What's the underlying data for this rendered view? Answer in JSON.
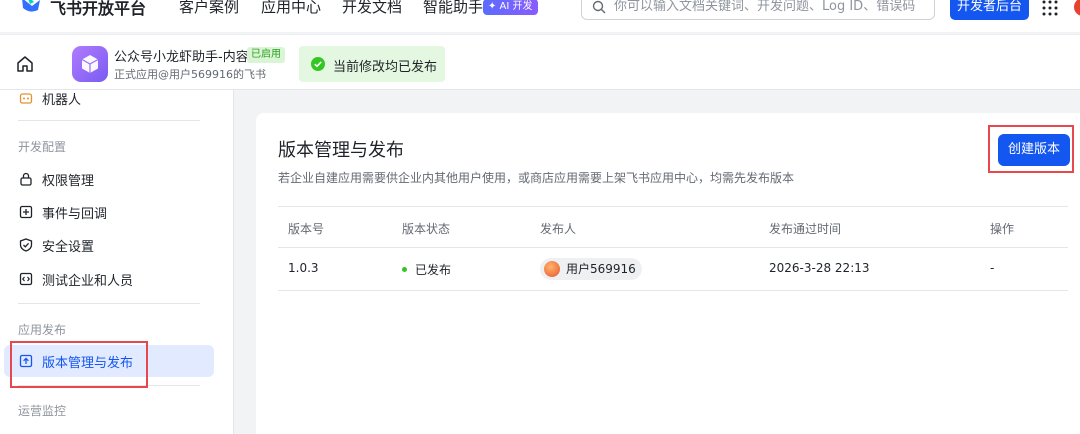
{
  "topbar": {
    "brand": "飞书开放平台",
    "nav": [
      "客户案例",
      "应用中心",
      "开发文档",
      "智能助手"
    ],
    "ai_badge": "✦ AI 开发",
    "search_placeholder": "你可以输入文档关键词、开发问题、Log ID、错误码",
    "dev_console_label": "开发者后台"
  },
  "appbar": {
    "app_name": "公众号小龙虾助手-内容",
    "enabled_badge": "已启用",
    "app_subtitle": "正式应用@用户569916的飞书",
    "publish_status": "当前修改均已发布"
  },
  "sidebar": {
    "top_item": "机器人",
    "groups": [
      {
        "title": "开发配置",
        "items": [
          "权限管理",
          "事件与回调",
          "安全设置",
          "测试企业和人员"
        ]
      },
      {
        "title": "应用发布",
        "items": [
          "版本管理与发布"
        ]
      },
      {
        "title": "运营监控",
        "items": []
      }
    ],
    "active_item": "版本管理与发布"
  },
  "main": {
    "title": "版本管理与发布",
    "description": "若企业自建应用需要供企业内其他用户使用，或商店应用需要上架飞书应用中心，均需先发布版本",
    "create_button": "创建版本",
    "columns": [
      "版本号",
      "版本状态",
      "发布人",
      "发布通过时间",
      "操作"
    ],
    "rows": [
      {
        "version": "1.0.3",
        "status": "已发布",
        "publisher": "用户569916",
        "time": "2026-3-28 22:13",
        "action": "-"
      }
    ]
  },
  "colors": {
    "primary": "#1456f0",
    "active_bg": "#e1eaff",
    "success": "#34c724",
    "highlight": "#e5484d"
  }
}
